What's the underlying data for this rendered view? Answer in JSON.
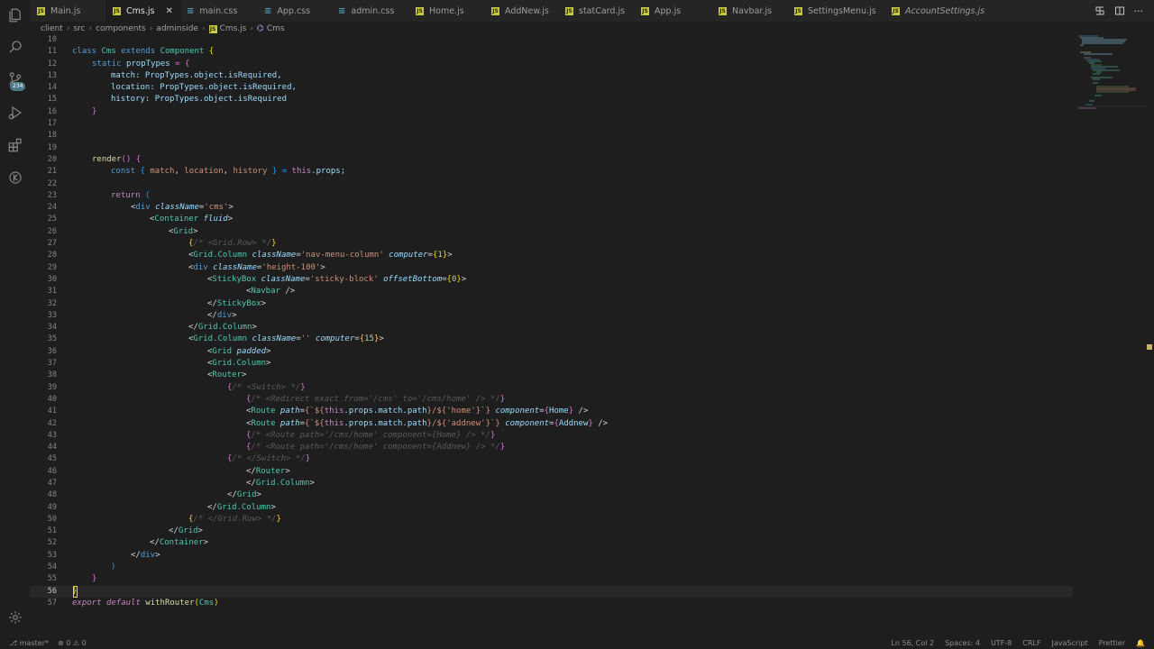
{
  "tabs": [
    {
      "label": "Main.js",
      "type": "js"
    },
    {
      "label": "Cms.js",
      "type": "js",
      "active": true
    },
    {
      "label": "main.css",
      "type": "css"
    },
    {
      "label": "App.css",
      "type": "css"
    },
    {
      "label": "admin.css",
      "type": "css"
    },
    {
      "label": "Home.js",
      "type": "js"
    },
    {
      "label": "AddNew.js",
      "type": "js"
    },
    {
      "label": "statCard.js",
      "type": "js"
    },
    {
      "label": "App.js",
      "type": "js"
    },
    {
      "label": "Navbar.js",
      "type": "js"
    },
    {
      "label": "SettingsMenu.js",
      "type": "js"
    },
    {
      "label": "AccountSettings.js",
      "type": "js"
    }
  ],
  "tab_close_glyph": "✕",
  "breadcrumb": [
    "client",
    "src",
    "components",
    "adminside",
    "Cms.js",
    "Cms"
  ],
  "activity_badge": "234",
  "line_numbers": [
    "10",
    "11",
    "12",
    "13",
    "14",
    "15",
    "16",
    "17",
    "18",
    "19",
    "20",
    "21",
    "22",
    "23",
    "24",
    "25",
    "26",
    "27",
    "28",
    "29",
    "30",
    "31",
    "32",
    "33",
    "34",
    "35",
    "36",
    "37",
    "38",
    "39",
    "40",
    "41",
    "42",
    "43",
    "44",
    "45",
    "46",
    "47",
    "48",
    "49",
    "50",
    "51",
    "52",
    "53",
    "54",
    "55",
    "56",
    "57"
  ],
  "code": {
    "l11": [
      "class ",
      "Cms",
      " extends ",
      "Component",
      " {"
    ],
    "l12": [
      "static ",
      "propTypes",
      " = {"
    ],
    "l13": [
      "match: PropTypes.object.isRequired,"
    ],
    "l14": [
      "location: PropTypes.object.isRequired,"
    ],
    "l15": [
      "history: PropTypes.object.isRequired"
    ],
    "l16": [
      "}"
    ],
    "l20": [
      "render",
      "() {"
    ],
    "l21": [
      "const ",
      "{ ",
      "match",
      ", ",
      "location",
      ", ",
      "history",
      " } = ",
      "this",
      ".props;"
    ],
    "l23": [
      "return ",
      "("
    ],
    "l24": [
      "<",
      "div",
      " className",
      "=",
      "'cms'",
      ">"
    ],
    "l25": [
      "<",
      "Container",
      " fluid",
      ">"
    ],
    "l26": [
      "<",
      "Grid",
      ">"
    ],
    "l27": [
      "{",
      "/* <Grid.Row> */",
      "}"
    ],
    "l28": [
      "<",
      "Grid.Column",
      " className",
      "=",
      "'nav-menu-column'",
      " computer",
      "=",
      "{",
      "1",
      "}",
      ">"
    ],
    "l29": [
      "<",
      "div",
      " className",
      "=",
      "'height-100'",
      ">"
    ],
    "l30": [
      "<",
      "StickyBox",
      " className",
      "=",
      "'sticky-block'",
      " offsetBottom",
      "=",
      "{",
      "0",
      "}",
      ">"
    ],
    "l31": [
      "<",
      "Navbar",
      " />"
    ],
    "l32": [
      "</",
      "StickyBox",
      ">"
    ],
    "l33": [
      "</",
      "div",
      ">"
    ],
    "l34": [
      "</",
      "Grid.Column",
      ">"
    ],
    "l35": [
      "<",
      "Grid.Column",
      " className",
      "=",
      "''",
      " computer",
      "=",
      "{",
      "15",
      "}",
      ">"
    ],
    "l36": [
      "<",
      "Grid",
      " padded",
      ">"
    ],
    "l37": [
      "<",
      "Grid.Column",
      ">"
    ],
    "l38": [
      "<",
      "Router",
      ">"
    ],
    "l39": [
      "{",
      "/* <Switch> */",
      "}"
    ],
    "l40": [
      "{",
      "/* <Redirect exact from='/cms' to='/cms/home' /> */",
      "}"
    ],
    "l41": [
      "<",
      "Route",
      " path",
      "=",
      "{`${",
      "this",
      ".props.match.path",
      "}/${",
      "'home'",
      "}`}",
      " component",
      "=",
      "{",
      "Home",
      "}",
      " />"
    ],
    "l42": [
      "<",
      "Route",
      " path",
      "=",
      "{`${",
      "this",
      ".props.match.path",
      "}/${",
      "'addnew'",
      "}`}",
      " component",
      "=",
      "{",
      "Addnew",
      "}",
      " />"
    ],
    "l43": [
      "{",
      "/* <Route path='/cms/home' component={Home} /> */",
      "}"
    ],
    "l44": [
      "{",
      "/* <Route path='/cms/home' component={Addnew} /> */",
      "}"
    ],
    "l45": [
      "{",
      "/* </Switch> */",
      "}"
    ],
    "l46": [
      "</",
      "Router",
      ">"
    ],
    "l47": [
      "</",
      "Grid.Column",
      ">"
    ],
    "l48": [
      "</",
      "Grid",
      ">"
    ],
    "l49": [
      "</",
      "Grid.Column",
      ">"
    ],
    "l50": [
      "{",
      "/* </Grid.Row> */",
      "}"
    ],
    "l51": [
      "</",
      "Grid",
      ">"
    ],
    "l52": [
      "</",
      "Container",
      ">"
    ],
    "l53": [
      "</",
      "div",
      ">"
    ],
    "l54": [
      ")"
    ],
    "l55": [
      "}"
    ],
    "l56": [
      "}"
    ],
    "l57": [
      "export ",
      "default ",
      "withRouter",
      "(",
      "Cms",
      ")"
    ]
  },
  "status": {
    "branch": "master*",
    "problems": "⊗ 0 ⚠ 0",
    "position": "Ln 56, Col 2",
    "spaces": "Spaces: 4",
    "encoding": "UTF-8",
    "eol": "CRLF",
    "language": "JavaScript",
    "formatter": "Prettier",
    "bell": "🔔"
  },
  "colors": {
    "background": "#1e1e1e",
    "tabbar": "#252526",
    "keyword": "#569cd6",
    "class": "#4ec9b0",
    "string": "#ce9178",
    "number": "#b5cea8"
  }
}
